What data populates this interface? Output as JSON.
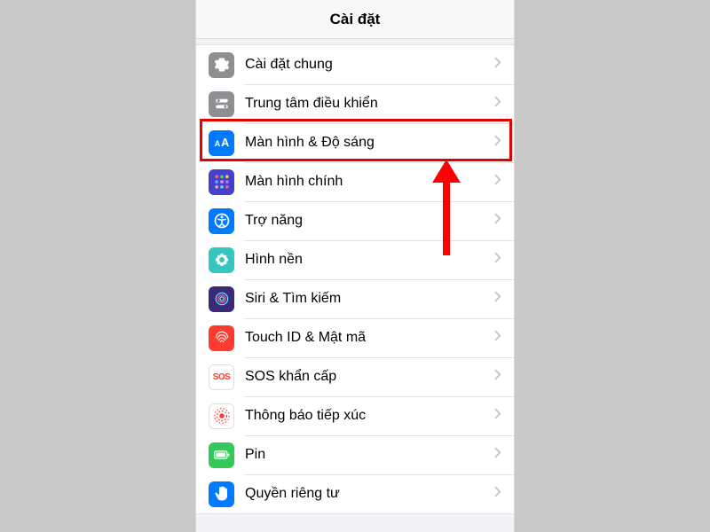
{
  "header": {
    "title": "Cài đặt"
  },
  "rows": [
    {
      "id": "general",
      "label": "Cài đặt chung"
    },
    {
      "id": "control",
      "label": "Trung tâm điều khiển"
    },
    {
      "id": "display",
      "label": "Màn hình & Độ sáng"
    },
    {
      "id": "home",
      "label": "Màn hình chính"
    },
    {
      "id": "accessibility",
      "label": "Trợ năng"
    },
    {
      "id": "wallpaper",
      "label": "Hình nền"
    },
    {
      "id": "siri",
      "label": "Siri & Tìm kiếm"
    },
    {
      "id": "touchid",
      "label": "Touch ID & Mật mã"
    },
    {
      "id": "sos",
      "label": "SOS khẩn cấp",
      "iconText": "SOS"
    },
    {
      "id": "exposure",
      "label": "Thông báo tiếp xúc"
    },
    {
      "id": "battery",
      "label": "Pin"
    },
    {
      "id": "privacy",
      "label": "Quyền riêng tư"
    }
  ],
  "annotation": {
    "highlightedRowIndex": 2
  }
}
